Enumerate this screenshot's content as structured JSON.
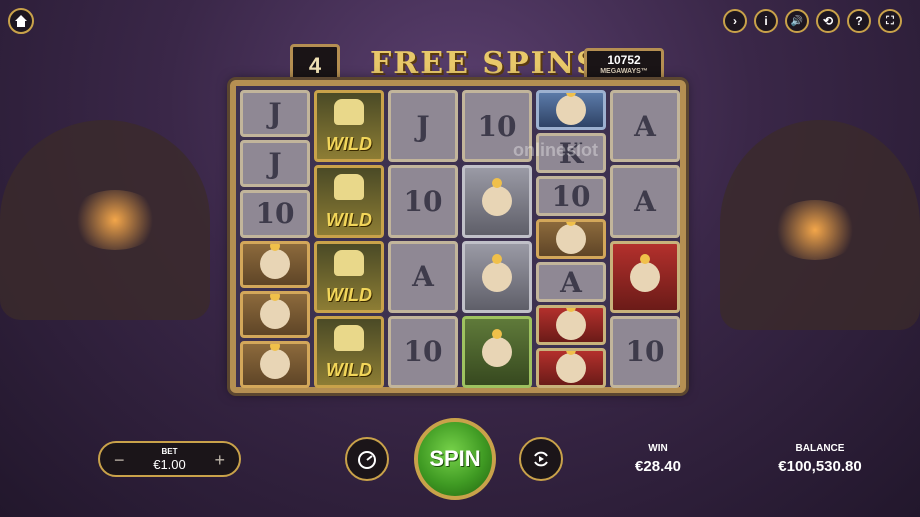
{
  "top_bar": {
    "buttons": [
      {
        "name": "forward-icon",
        "glyph": "›"
      },
      {
        "name": "info-icon",
        "glyph": "i"
      },
      {
        "name": "volume-icon",
        "glyph": "🔊"
      },
      {
        "name": "history-icon",
        "glyph": "⟲"
      },
      {
        "name": "help-icon",
        "glyph": "?"
      },
      {
        "name": "fullscreen-icon",
        "glyph": "⛶"
      }
    ]
  },
  "free_spins": {
    "count": "4",
    "title": "FREE SPINS",
    "ways_value": "10752",
    "ways_label": "MEGAWAYS™"
  },
  "watermark": "onlineslot",
  "reels": [
    [
      "J",
      "J",
      "10",
      "warrior",
      "warrior",
      "warrior"
    ],
    [
      "wild",
      "wild",
      "wild",
      "wild"
    ],
    [
      "J",
      "10",
      "A",
      "10"
    ],
    [
      "10",
      "armor",
      "armor",
      "green-dodo"
    ],
    [
      "blue",
      "K",
      "10",
      "warrior",
      "A",
      "bird",
      "bird"
    ],
    [
      "A",
      "A",
      "bird",
      "10"
    ]
  ],
  "wild_label": "WILD",
  "bet": {
    "label": "BET",
    "value": "€1.00",
    "minus": "−",
    "plus": "+"
  },
  "spin_label": "SPIN",
  "win": {
    "label": "WIN",
    "value": "€28.40"
  },
  "balance": {
    "label": "BALANCE",
    "value": "€100,530.80"
  }
}
